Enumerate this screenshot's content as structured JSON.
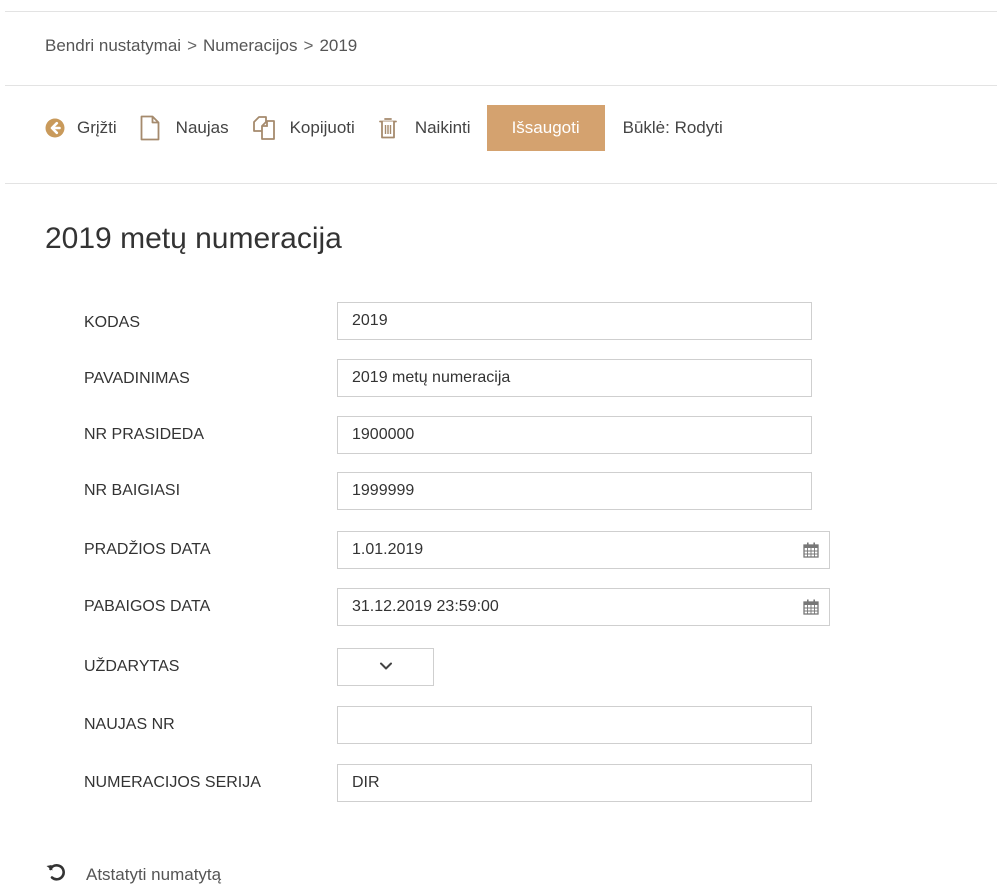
{
  "breadcrumb": {
    "items": [
      "Bendri nustatymai",
      "Numeracijos",
      "2019"
    ],
    "separator": ">"
  },
  "toolbar": {
    "back_label": "Grįžti",
    "new_label": "Naujas",
    "copy_label": "Kopijuoti",
    "delete_label": "Naikinti",
    "save_label": "Išsaugoti",
    "status_label": "Būklė: Rodyti"
  },
  "page_title": "2019 metų numeracija",
  "form": {
    "kodas": {
      "label": "KODAS",
      "value": "2019"
    },
    "pavadinimas": {
      "label": "PAVADINIMAS",
      "value": "2019 metų numeracija"
    },
    "nr_prasideda": {
      "label": "NR PRASIDEDA",
      "value": "1900000"
    },
    "nr_baigiasi": {
      "label": "NR BAIGIASI",
      "value": "1999999"
    },
    "pradzios_data": {
      "label": "PRADŽIOS DATA",
      "value": "1.01.2019"
    },
    "pabaigos_data": {
      "label": "PABAIGOS DATA",
      "value": "31.12.2019 23:59:00"
    },
    "uzdarytas": {
      "label": "UŽDARYTAS",
      "value": ""
    },
    "naujas_nr": {
      "label": "NAUJAS NR",
      "value": ""
    },
    "numeracijos_serija": {
      "label": "NUMERACIJOS SERIJA",
      "value": "DIR"
    }
  },
  "reset_label": "Atstatyti numatytą",
  "colors": {
    "accent": "#d4a26f",
    "back_icon": "#c99a5b",
    "icon": "#a58a6d",
    "border": "#cfcfcf"
  },
  "icons": {
    "back": "arrow-circle-left-icon",
    "new": "file-icon",
    "copy": "copy-icon",
    "delete": "trash-icon",
    "calendar": "calendar-icon",
    "dropdown": "chevron-down-icon",
    "reset": "undo-icon"
  }
}
